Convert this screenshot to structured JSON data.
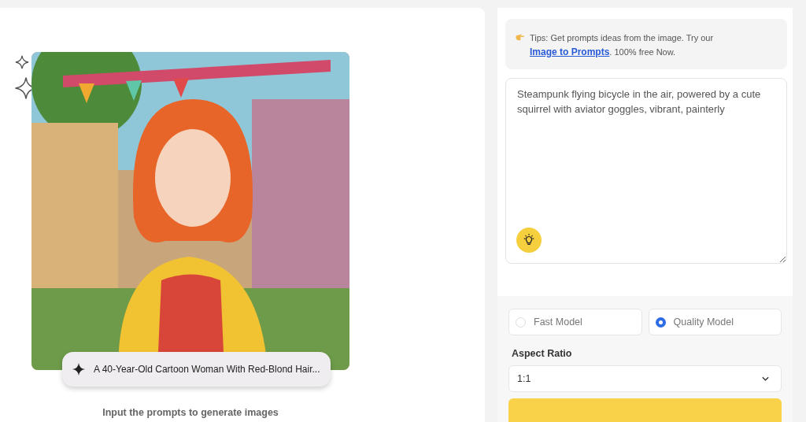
{
  "preview": {
    "kind": "picture",
    "caption": "A 40-Year-Old Cartoon Woman With Red-Blond Hair...",
    "hint": "Input the prompts to generate images"
  },
  "tips": {
    "before": "Tips: Get prompts ideas from the image. Try our ",
    "link": "Image to Prompts",
    "after": ". 100% free Now."
  },
  "prompt": {
    "value": "Steampunk flying bicycle in the air, powered by a cute squirrel with aviator goggles, vibrant, painterly"
  },
  "models": [
    {
      "label": "Fast Model",
      "selected": false
    },
    {
      "label": "Quality Model",
      "selected": true
    }
  ],
  "aspect_ratio": {
    "label": "Aspect Ratio",
    "value": "1:1"
  }
}
